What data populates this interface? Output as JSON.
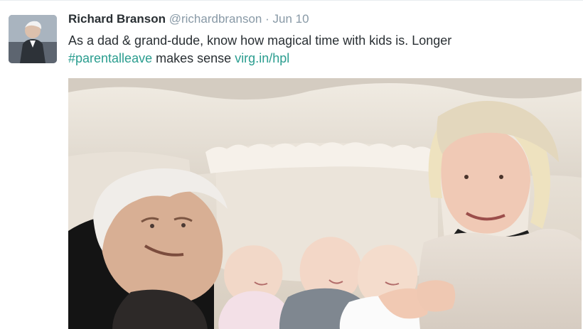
{
  "tweet": {
    "author_name": "Richard Branson",
    "author_handle": "@richardbranson",
    "date_separator": "·",
    "date": "Jun 10",
    "text": {
      "part1": "As a dad & grand-dude, know how magical time with kids is. Longer",
      "hashtag": "#parentalleave",
      "part2": "makes sense",
      "link": "virg.in/hpl"
    }
  },
  "colors": {
    "link": "#2a9d8f",
    "muted": "#8899a6",
    "text": "#292f33"
  },
  "icons": {
    "avatar": "profile-photo",
    "media": "family-photo"
  }
}
